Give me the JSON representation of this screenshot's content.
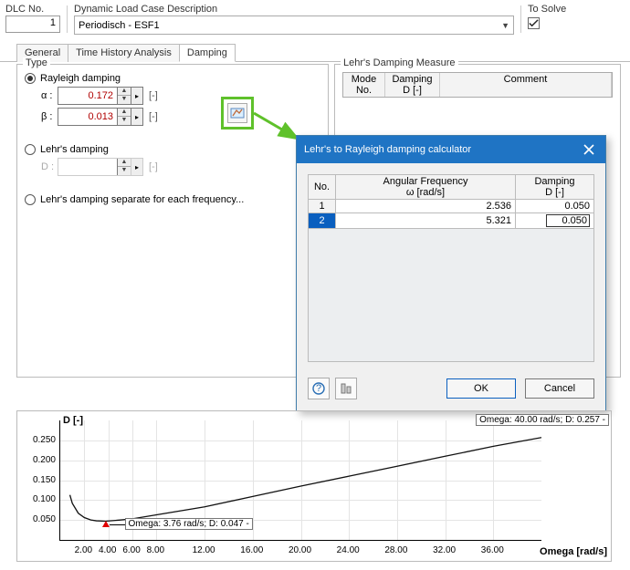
{
  "header": {
    "dlc_label": "DLC No.",
    "dlc_value": "1",
    "desc_label": "Dynamic Load Case Description",
    "desc_value": "Periodisch - ESF1",
    "solve_label": "To Solve"
  },
  "tabs": {
    "general": "General",
    "time": "Time History Analysis",
    "damping": "Damping"
  },
  "type_panel": {
    "title": "Type",
    "rayleigh": "Rayleigh damping",
    "alpha_sym": "α :",
    "alpha_val": "0.172",
    "beta_sym": "β :",
    "beta_val": "0.013",
    "unit": "[-]",
    "lehrs": "Lehr's damping",
    "d_sym": "D :",
    "lehrs_sep": "Lehr's damping separate for each frequency..."
  },
  "lehrs_panel": {
    "title": "Lehr's Damping Measure",
    "col_mode": "Mode\nNo.",
    "col_damp": "Damping\nD [-]",
    "col_comment": "Comment"
  },
  "dialog": {
    "title": "Lehr's to Rayleigh damping calculator",
    "col_no": "No.",
    "col_freq": "Angular Frequency\nω [rad/s]",
    "col_damp": "Damping\nD [-]",
    "rows": [
      {
        "no": "1",
        "freq": "2.536",
        "d": "0.050"
      },
      {
        "no": "2",
        "freq": "5.321",
        "d": "0.050"
      }
    ],
    "ok": "OK",
    "cancel": "Cancel"
  },
  "chart": {
    "ylabel": "D [-]",
    "xlabel": "Omega [rad/s]",
    "yticks": [
      "0.050",
      "0.100",
      "0.150",
      "0.200",
      "0.250"
    ],
    "xticks": [
      "2.00",
      "4.00",
      "6.00",
      "8.00",
      "12.00",
      "16.00",
      "20.00",
      "24.00",
      "28.00",
      "32.00",
      "36.00"
    ],
    "tip_min": "Omega: 3.76 rad/s; D: 0.047 -",
    "tip_end": "Omega: 40.00 rad/s; D: 0.257 -"
  },
  "chart_data": {
    "type": "line",
    "title": "",
    "xlabel": "Omega [rad/s]",
    "ylabel": "D [-]",
    "xlim": [
      0,
      40
    ],
    "ylim": [
      0,
      0.3
    ],
    "series": [
      {
        "name": "D",
        "x": [
          0.8,
          1.0,
          1.5,
          2.0,
          2.54,
          3.0,
          3.76,
          5.0,
          6.0,
          8.0,
          12.0,
          16.0,
          20.0,
          24.0,
          28.0,
          32.0,
          36.0,
          40.0
        ],
        "y": [
          0.113,
          0.092,
          0.067,
          0.056,
          0.05,
          0.048,
          0.047,
          0.05,
          0.053,
          0.063,
          0.083,
          0.109,
          0.135,
          0.16,
          0.185,
          0.21,
          0.235,
          0.257
        ]
      }
    ],
    "annotations": [
      {
        "x": 3.76,
        "y": 0.047,
        "text": "Omega: 3.76 rad/s; D: 0.047 -"
      },
      {
        "x": 40.0,
        "y": 0.257,
        "text": "Omega: 40.00 rad/s; D: 0.257 -"
      }
    ]
  }
}
